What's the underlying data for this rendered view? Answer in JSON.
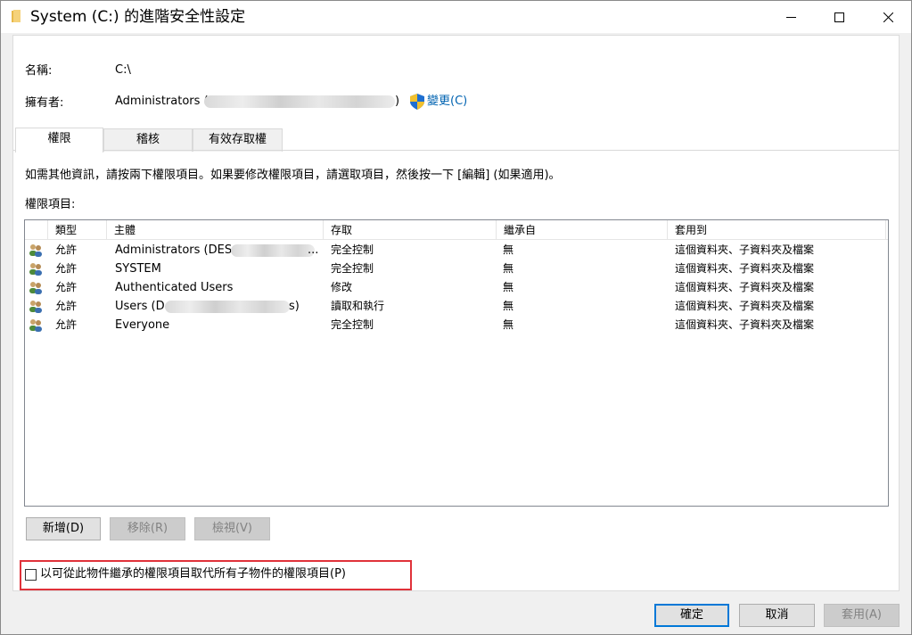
{
  "window": {
    "title": "System (C:) 的進階安全性設定"
  },
  "info": {
    "name_label": "名稱:",
    "name_value": "C:\\",
    "owner_label": "擁有者:",
    "owner_value_prefix": "Administrators (",
    "owner_value_suffix": ")",
    "change_link": "變更(C)"
  },
  "tabs": [
    {
      "label": "權限",
      "active": true
    },
    {
      "label": "稽核",
      "active": false
    },
    {
      "label": "有效存取權",
      "active": false
    }
  ],
  "instructions": "如需其他資訊，請按兩下權限項目。如果要修改權限項目，請選取項目，然後按一下 [編輯] (如果適用)。",
  "list_label": "權限項目:",
  "columns": [
    "類型",
    "主體",
    "存取",
    "繼承自",
    "套用到"
  ],
  "entries": [
    {
      "type": "允許",
      "principal": "Administrators (DESK",
      "principal_tail": "...",
      "access": "完全控制",
      "inherited": "無",
      "applies": "這個資料夾、子資料夾及檔案"
    },
    {
      "type": "允許",
      "principal": "SYSTEM",
      "principal_tail": "",
      "access": "完全控制",
      "inherited": "無",
      "applies": "這個資料夾、子資料夾及檔案"
    },
    {
      "type": "允許",
      "principal": "Authenticated Users",
      "principal_tail": "",
      "access": "修改",
      "inherited": "無",
      "applies": "這個資料夾、子資料夾及檔案"
    },
    {
      "type": "允許",
      "principal": "Users (D",
      "principal_tail": "s)",
      "access": "讀取和執行",
      "inherited": "無",
      "applies": "這個資料夾、子資料夾及檔案"
    },
    {
      "type": "允許",
      "principal": "Everyone",
      "principal_tail": "",
      "access": "完全控制",
      "inherited": "無",
      "applies": "這個資料夾、子資料夾及檔案"
    }
  ],
  "buttons": {
    "add": "新增(D)",
    "remove": "移除(R)",
    "view": "檢視(V)"
  },
  "replace_checkbox": {
    "label": "以可從此物件繼承的權限項目取代所有子物件的權限項目(P)",
    "checked": false
  },
  "footer": {
    "ok": "確定",
    "cancel": "取消",
    "apply": "套用(A)"
  },
  "colors": {
    "link": "#0063b1",
    "highlight_outline": "#e0323a",
    "primary_border": "#0078d7"
  }
}
